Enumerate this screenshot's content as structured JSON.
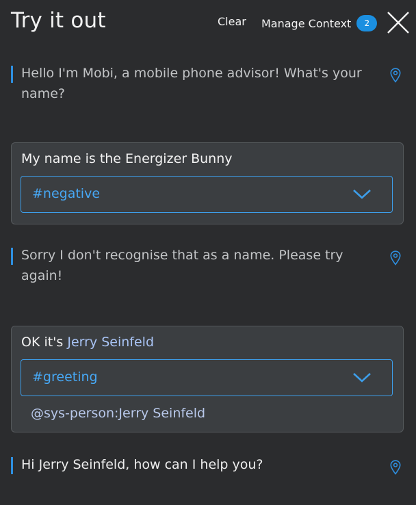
{
  "header": {
    "title": "Try it out",
    "clear_label": "Clear",
    "manage_context_label": "Manage Context",
    "context_count": "2"
  },
  "conversation": {
    "bot_message_1": "Hello I'm Mobi, a mobile phone advisor! What's your name?",
    "user_message_1": {
      "text": "My name is the Energizer Bunny",
      "intent": "#negative"
    },
    "bot_message_2": "Sorry I don't recognise that as a name. Please try again!",
    "user_message_2": {
      "prefix": "OK it's ",
      "entity_text": "Jerry Seinfeld",
      "intent": "#greeting",
      "entity": "@sys-person:Jerry Seinfeld"
    },
    "bot_message_3": "Hi Jerry Seinfeld, how can I help you?"
  },
  "colors": {
    "background": "#2b2c2e",
    "accent": "#2e8fe0",
    "badge": "#1b8fe0",
    "entity": "#a9c4f5"
  },
  "icons": [
    "close-icon",
    "location-pin-icon",
    "chevron-down-icon"
  ]
}
